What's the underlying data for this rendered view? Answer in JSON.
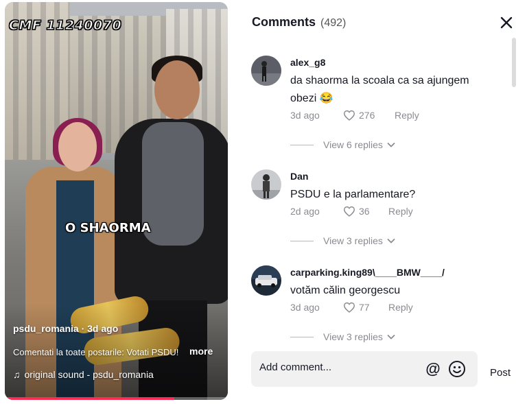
{
  "video": {
    "watermark": "CMF 11240070",
    "caption": "O SHAORMA",
    "author_line": "psdu_romania · 3d ago",
    "description": "Comentati la toate postarile: Votati PSDU!",
    "more_label": "more",
    "sound": "original sound - psdu_romania",
    "progress": 0.76,
    "accent_color": "#fe2c55"
  },
  "comments_panel": {
    "title": "Comments",
    "count": "(492)",
    "close_icon": "close-icon",
    "comments": [
      {
        "username": "alex_g8",
        "text": "da shaorma la scoala ca sa ajungem obezi",
        "emoji": "😂",
        "date": "3d ago",
        "likes": "276",
        "reply_label": "Reply",
        "view_replies": "View 6 replies"
      },
      {
        "username": "Dan",
        "text": "PSDU e la parlamentare?",
        "date": "2d ago",
        "likes": "36",
        "reply_label": "Reply",
        "view_replies": "View 3 replies"
      },
      {
        "username": "carparking.king89\\____BMW____/",
        "text": "votăm călin georgescu",
        "date": "3d ago",
        "likes": "77",
        "reply_label": "Reply",
        "view_replies": "View 3 replies"
      }
    ],
    "add_comment_placeholder": "Add comment...",
    "mention_symbol": "@",
    "post_label": "Post"
  }
}
